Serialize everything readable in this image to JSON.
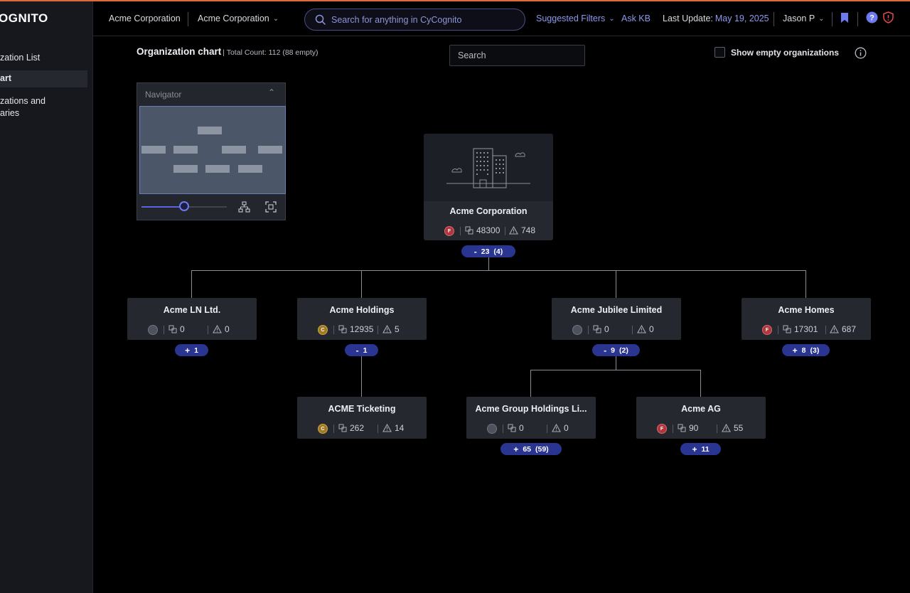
{
  "brand": {
    "logo_text": "OGNITO"
  },
  "sidebar": {
    "items": [
      {
        "label": "zation List"
      },
      {
        "label": "art"
      },
      {
        "label": "zations and"
      },
      {
        "label": "aries"
      }
    ]
  },
  "header": {
    "org_current": "Acme Corporation",
    "org_select": "Acme Corporation",
    "search_placeholder": "Search for anything in CyCognito",
    "suggested_filters": "Suggested Filters",
    "ask_kb": "Ask KB",
    "last_update_label": "Last Update:",
    "last_update_date": "May 19, 2025",
    "user": "Jason P"
  },
  "page": {
    "title": "Organization chart",
    "total_count": "| Total Count: 112 (88 empty)",
    "search_placeholder": "Search",
    "show_empty_label": "Show empty organizations"
  },
  "navigator": {
    "title": "Navigator",
    "zoom": 0.5
  },
  "orgs": {
    "root": {
      "name": "Acme Corporation",
      "badge": "F",
      "assets": "48300",
      "issues": "748",
      "expander": {
        "sign": "-",
        "count": "23",
        "extra": "(4)"
      }
    },
    "ln": {
      "name": "Acme LN Ltd.",
      "badge": "",
      "assets": "0",
      "issues": "0",
      "expander": {
        "sign": "+",
        "count": "1",
        "extra": ""
      }
    },
    "holdings": {
      "name": "Acme Holdings",
      "badge": "C",
      "assets": "12935",
      "issues": "5",
      "expander": {
        "sign": "-",
        "count": "1",
        "extra": ""
      }
    },
    "jubilee": {
      "name": "Acme Jubilee Limited",
      "badge": "",
      "assets": "0",
      "issues": "0",
      "expander": {
        "sign": "-",
        "count": "9",
        "extra": "(2)"
      }
    },
    "homes": {
      "name": "Acme Homes",
      "badge": "F",
      "assets": "17301",
      "issues": "687",
      "expander": {
        "sign": "+",
        "count": "8",
        "extra": "(3)"
      }
    },
    "ticketing": {
      "name": "ACME Ticketing",
      "badge": "C",
      "assets": "262",
      "issues": "14"
    },
    "group": {
      "name": "Acme Group Holdings Li...",
      "badge": "",
      "assets": "0",
      "issues": "0",
      "expander": {
        "sign": "+",
        "count": "65",
        "extra": "(59)"
      }
    },
    "ag": {
      "name": "Acme AG",
      "badge": "F",
      "assets": "90",
      "issues": "55",
      "expander": {
        "sign": "+",
        "count": "11",
        "extra": ""
      }
    }
  },
  "colors": {
    "accent": "#2a3491",
    "link": "#8e98ee",
    "grade_f": "#b2343c",
    "grade_c": "#a07a22",
    "top_line": "#e0683a"
  }
}
